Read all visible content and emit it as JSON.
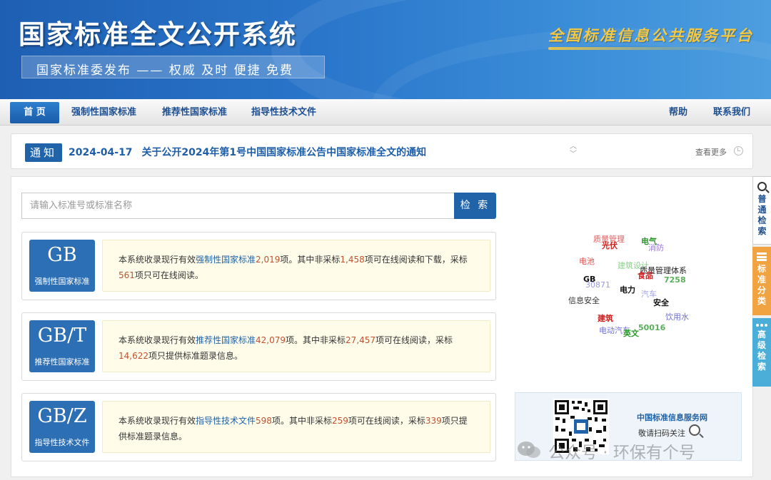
{
  "banner": {
    "title": "国家标准全文公开系统",
    "subtitle": "国家标准委发布 —— 权威 及时 便捷 免费",
    "platform": "全国标准信息公共服务平台"
  },
  "nav": {
    "home": "首 页",
    "mandatory": "强制性国家标准",
    "recommended": "推荐性国家标准",
    "guidance": "指导性技术文件",
    "help": "帮助",
    "contact": "联系我们"
  },
  "notice": {
    "badge": "通知",
    "date": "2024-04-17",
    "text": "关于公开2024年第1号中国国家标准公告中国家标准全文的通知",
    "more": "查看更多"
  },
  "search": {
    "placeholder": "请输入标准号或标准名称",
    "button": "检 索"
  },
  "cards": [
    {
      "code": "GB",
      "label": "强制性国家标准",
      "p1": "本系统收录现行有效",
      "link": "强制性国家标准",
      "n1": "2,019",
      "p2": "项。其中非采标",
      "n2": "1,458",
      "p3": "项可在线阅读和下载，采标",
      "n3": "561",
      "p4": "项只可在线阅读。"
    },
    {
      "code": "GB/T",
      "label": "推荐性国家标准",
      "p1": "本系统收录现行有效",
      "link": "推荐性国家标准",
      "n1": "42,079",
      "p2": "项。其中非采标",
      "n2": "27,457",
      "p3": "项可在线阅读，采标",
      "n3": "14,622",
      "p4": "项只提供标准题录信息。"
    },
    {
      "code": "GB/Z",
      "label": "指导性技术文件",
      "p1": "本系统收录现行有效",
      "link": "指导性技术文件",
      "n1": "598",
      "p2": "项。其中非采标",
      "n2": "259",
      "p3": "项可在线阅读，采标",
      "n3": "339",
      "p4": "项只提供标准题录信息。"
    }
  ],
  "word_cloud": [
    {
      "text": "质量管理",
      "color": "#e06060"
    },
    {
      "text": "光伏",
      "color": "#d02020"
    },
    {
      "text": "电气",
      "color": "#2a9a2a"
    },
    {
      "text": "消防",
      "color": "#9a7ad8"
    },
    {
      "text": "电池",
      "color": "#e05050"
    },
    {
      "text": "建筑设计",
      "color": "#8ad08a"
    },
    {
      "text": "质量管理体系",
      "color": "#222222"
    },
    {
      "text": "食品",
      "color": "#d02020"
    },
    {
      "text": "GB",
      "color": "#111111"
    },
    {
      "text": "30871",
      "color": "#9a9ae0"
    },
    {
      "text": "7258",
      "color": "#5ab05a"
    },
    {
      "text": "电力",
      "color": "#111111"
    },
    {
      "text": "汽车",
      "color": "#a0a0e8"
    },
    {
      "text": "信息安全",
      "color": "#333333"
    },
    {
      "text": "安全",
      "color": "#111111"
    },
    {
      "text": "建筑",
      "color": "#d02020"
    },
    {
      "text": "饮用水",
      "color": "#7070d0"
    },
    {
      "text": "电动汽车",
      "color": "#7070d8"
    },
    {
      "text": "50016",
      "color": "#5ab05a"
    },
    {
      "text": "英文",
      "color": "#2a9a2a"
    }
  ],
  "qr": {
    "title": "中国标准信息服务网",
    "subtitle": "敬请扫码关注"
  },
  "side_tabs": {
    "search": "普通检索",
    "category": "标准分类",
    "advanced": "高级检索"
  },
  "watermark": "公众号 · 环保有个号",
  "colors": {
    "primary": "#2163a8",
    "accent_orange": "#f0a340",
    "accent_cyan": "#4aaed8",
    "highlight_num": "#c2512f"
  }
}
